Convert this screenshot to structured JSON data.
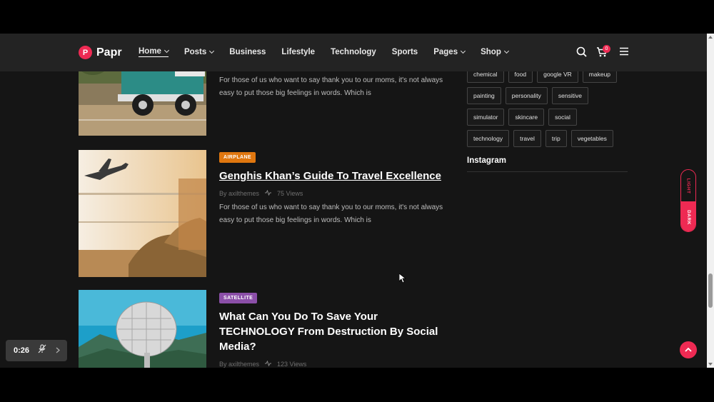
{
  "header": {
    "logo_mark": "P",
    "logo_text": "Papr",
    "nav": [
      {
        "label": "Home",
        "dropdown": true,
        "active": true
      },
      {
        "label": "Posts",
        "dropdown": true
      },
      {
        "label": "Business",
        "dropdown": false
      },
      {
        "label": "Lifestyle",
        "dropdown": false
      },
      {
        "label": "Technology",
        "dropdown": false
      },
      {
        "label": "Sports",
        "dropdown": false
      },
      {
        "label": "Pages",
        "dropdown": true
      },
      {
        "label": "Shop",
        "dropdown": true
      }
    ],
    "cart_count": "0"
  },
  "posts": [
    {
      "excerpt": "For those of us who want to say thank you to our moms, it's not always easy to put those big feelings in words. Which is"
    },
    {
      "category": "AIRPLANE",
      "category_color": "#e0770f",
      "title": "Genghis Khan’s Guide To Travel Excellence",
      "author": "By axilthemes",
      "views": "75 Views",
      "excerpt": "For those of us who want to say thank you to our moms, it's not always easy to put those big feelings in words. Which is"
    },
    {
      "category": "SATELLITE",
      "category_color": "#8b4fa8",
      "title": "What Can You Do To Save Your TECHNOLOGY From Destruction By Social Media?",
      "author": "By axilthemes",
      "views": "123 Views"
    }
  ],
  "sidebar": {
    "tag_rows": [
      [
        "chemical",
        "food",
        "google VR",
        "makeup"
      ],
      [
        "painting",
        "personality",
        "sensitive"
      ],
      [
        "simulator",
        "skincare",
        "social"
      ],
      [
        "technology",
        "travel",
        "trip",
        "vegetables"
      ]
    ],
    "instagram_title": "Instagram"
  },
  "theme_toggle": {
    "light": "LIGHT",
    "dark": "DARK"
  },
  "player": {
    "time": "0:26"
  },
  "colors": {
    "accent": "#ee2a53",
    "background": "#151515",
    "header": "#232323"
  }
}
